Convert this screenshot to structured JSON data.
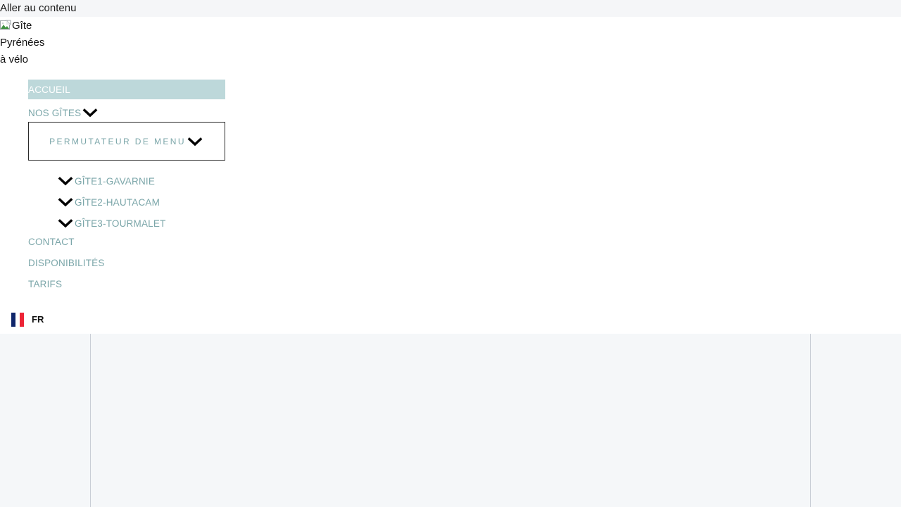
{
  "skip_link": {
    "label": "Aller au contenu"
  },
  "logo": {
    "alt_line1": "Gîte",
    "alt_line2": "Pyrénées",
    "alt_line3": "à vélo",
    "icon": "broken-image-icon"
  },
  "nav": {
    "accueil": "ACCUEIL",
    "nos_gites": "NOS GÎTES",
    "menu_toggle": "PERMUTATEUR DE MENU",
    "submenu": [
      {
        "label": "GÎTE1-GAVARNIE"
      },
      {
        "label": "GÎTE2-HAUTACAM"
      },
      {
        "label": "GÎTE3-TOURMALET"
      }
    ],
    "contact": "CONTACT",
    "disponibilites": "DISPONIBILITÉS",
    "tarifs": "TARIFS"
  },
  "language": {
    "code": "FR",
    "flag": "france-flag-icon"
  },
  "colors": {
    "accent_teal": "#7ba6a9",
    "active_bg": "#bdd8da",
    "skip_bar_bg": "#f5f6f8",
    "content_bg": "#f5f7f9",
    "divider": "#c9ced6"
  }
}
